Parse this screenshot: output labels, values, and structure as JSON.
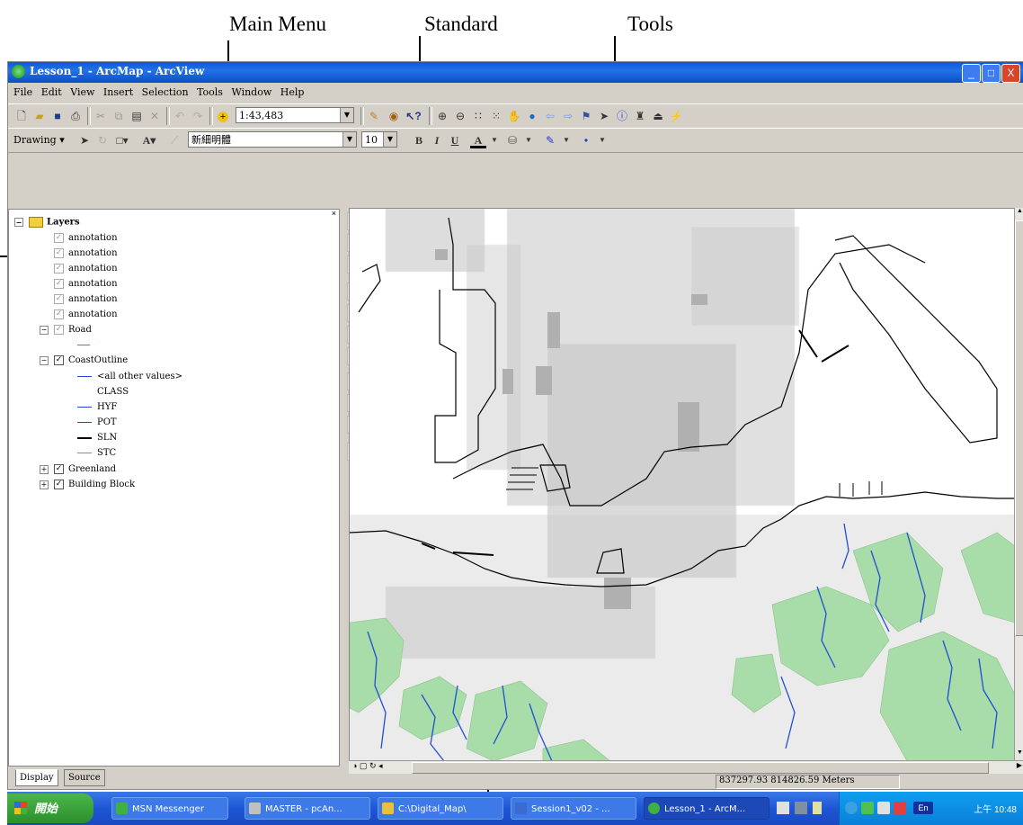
{
  "callouts": {
    "main_menu": "Main Menu",
    "standard": "Standard",
    "tools": "Tools"
  },
  "window": {
    "title": "Lesson_1 - ArcMap - ArcView",
    "min": "_",
    "max": "□",
    "close": "X"
  },
  "menu": {
    "items": [
      "File",
      "Edit",
      "View",
      "Insert",
      "Selection",
      "Tools",
      "Window",
      "Help"
    ]
  },
  "standard_toolbar": {
    "scale": "1:43,483"
  },
  "drawing_toolbar": {
    "drawing_label": "Drawing ▾",
    "font_name": "新細明體",
    "font_size": "10",
    "bold": "B",
    "italic": "I",
    "underline": "U",
    "font_color": "A"
  },
  "toc": {
    "root": "Layers",
    "annotations": [
      "annotation",
      "annotation",
      "annotation",
      "annotation",
      "annotation",
      "annotation"
    ],
    "road": "Road",
    "coast": "CoastOutline",
    "coast_legend": [
      "<all other values>",
      "CLASS",
      "HYF",
      "POT",
      "SLN",
      "STC"
    ],
    "greenland": "Greenland",
    "building": "Building Block"
  },
  "tabs": {
    "display": "Display",
    "source": "Source"
  },
  "status": {
    "coordinates": "837297.93  814826.59 Meters"
  },
  "taskbar": {
    "start": "開始",
    "tasks": [
      "MSN Messenger",
      "MASTER - pcAn...",
      "C:\\Digital_Map\\",
      "Session1_v02 - ...",
      "Lesson_1 - ArcM..."
    ],
    "lang": "En",
    "clock": "上午 10:48"
  },
  "colors": {
    "green_land": "#a8dca8",
    "rivers": "#1f4fd6",
    "buildings": "#bdbdbd"
  }
}
